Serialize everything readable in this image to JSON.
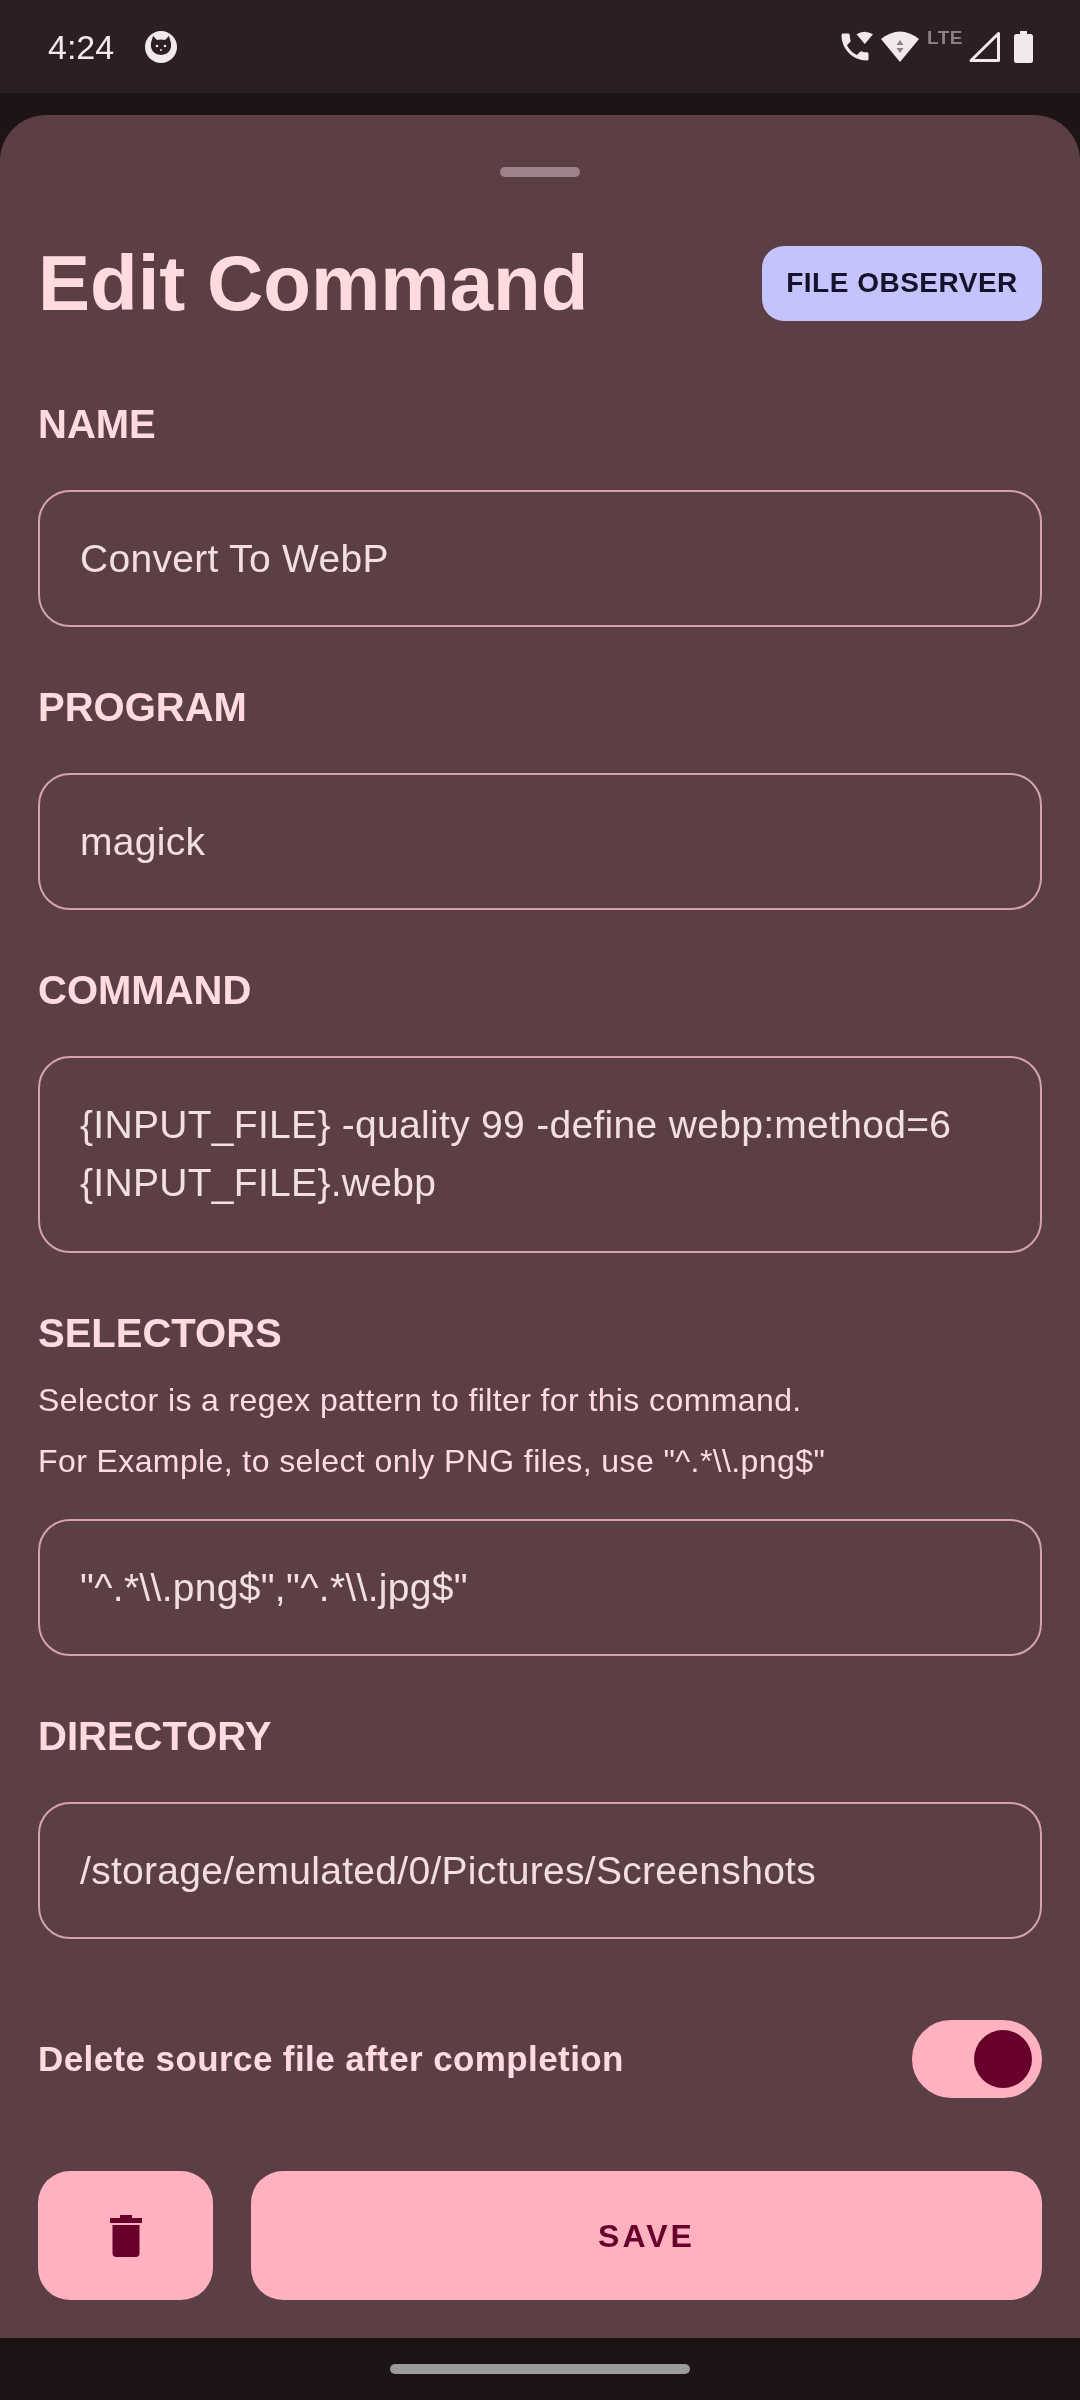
{
  "status_bar": {
    "time": "4:24",
    "network_type": "LTE"
  },
  "sheet": {
    "title": "Edit Command",
    "mode_button": "FILE OBSERVER"
  },
  "fields": [
    {
      "kind": "single",
      "label": "NAME",
      "value": "Convert To WebP"
    },
    {
      "kind": "single",
      "label": "PROGRAM",
      "value": "magick"
    },
    {
      "kind": "multiline",
      "label": "COMMAND",
      "value": "{INPUT_FILE} -quality 99 -define webp:method=6 {INPUT_FILE}.webp"
    },
    {
      "kind": "single",
      "label": "SELECTORS",
      "description": [
        "Selector is a regex pattern to filter for this command.",
        "For Example, to select only PNG files, use \"^.*\\\\.png$\""
      ],
      "value": "\"^.*\\\\.png$\",\"^.*\\\\.jpg$\""
    },
    {
      "kind": "single",
      "label": "DIRECTORY",
      "value": "/storage/emulated/0/Pictures/Screenshots"
    }
  ],
  "toggle": {
    "label": "Delete source file after completion",
    "on": true
  },
  "actions": {
    "save": "SAVE"
  }
}
